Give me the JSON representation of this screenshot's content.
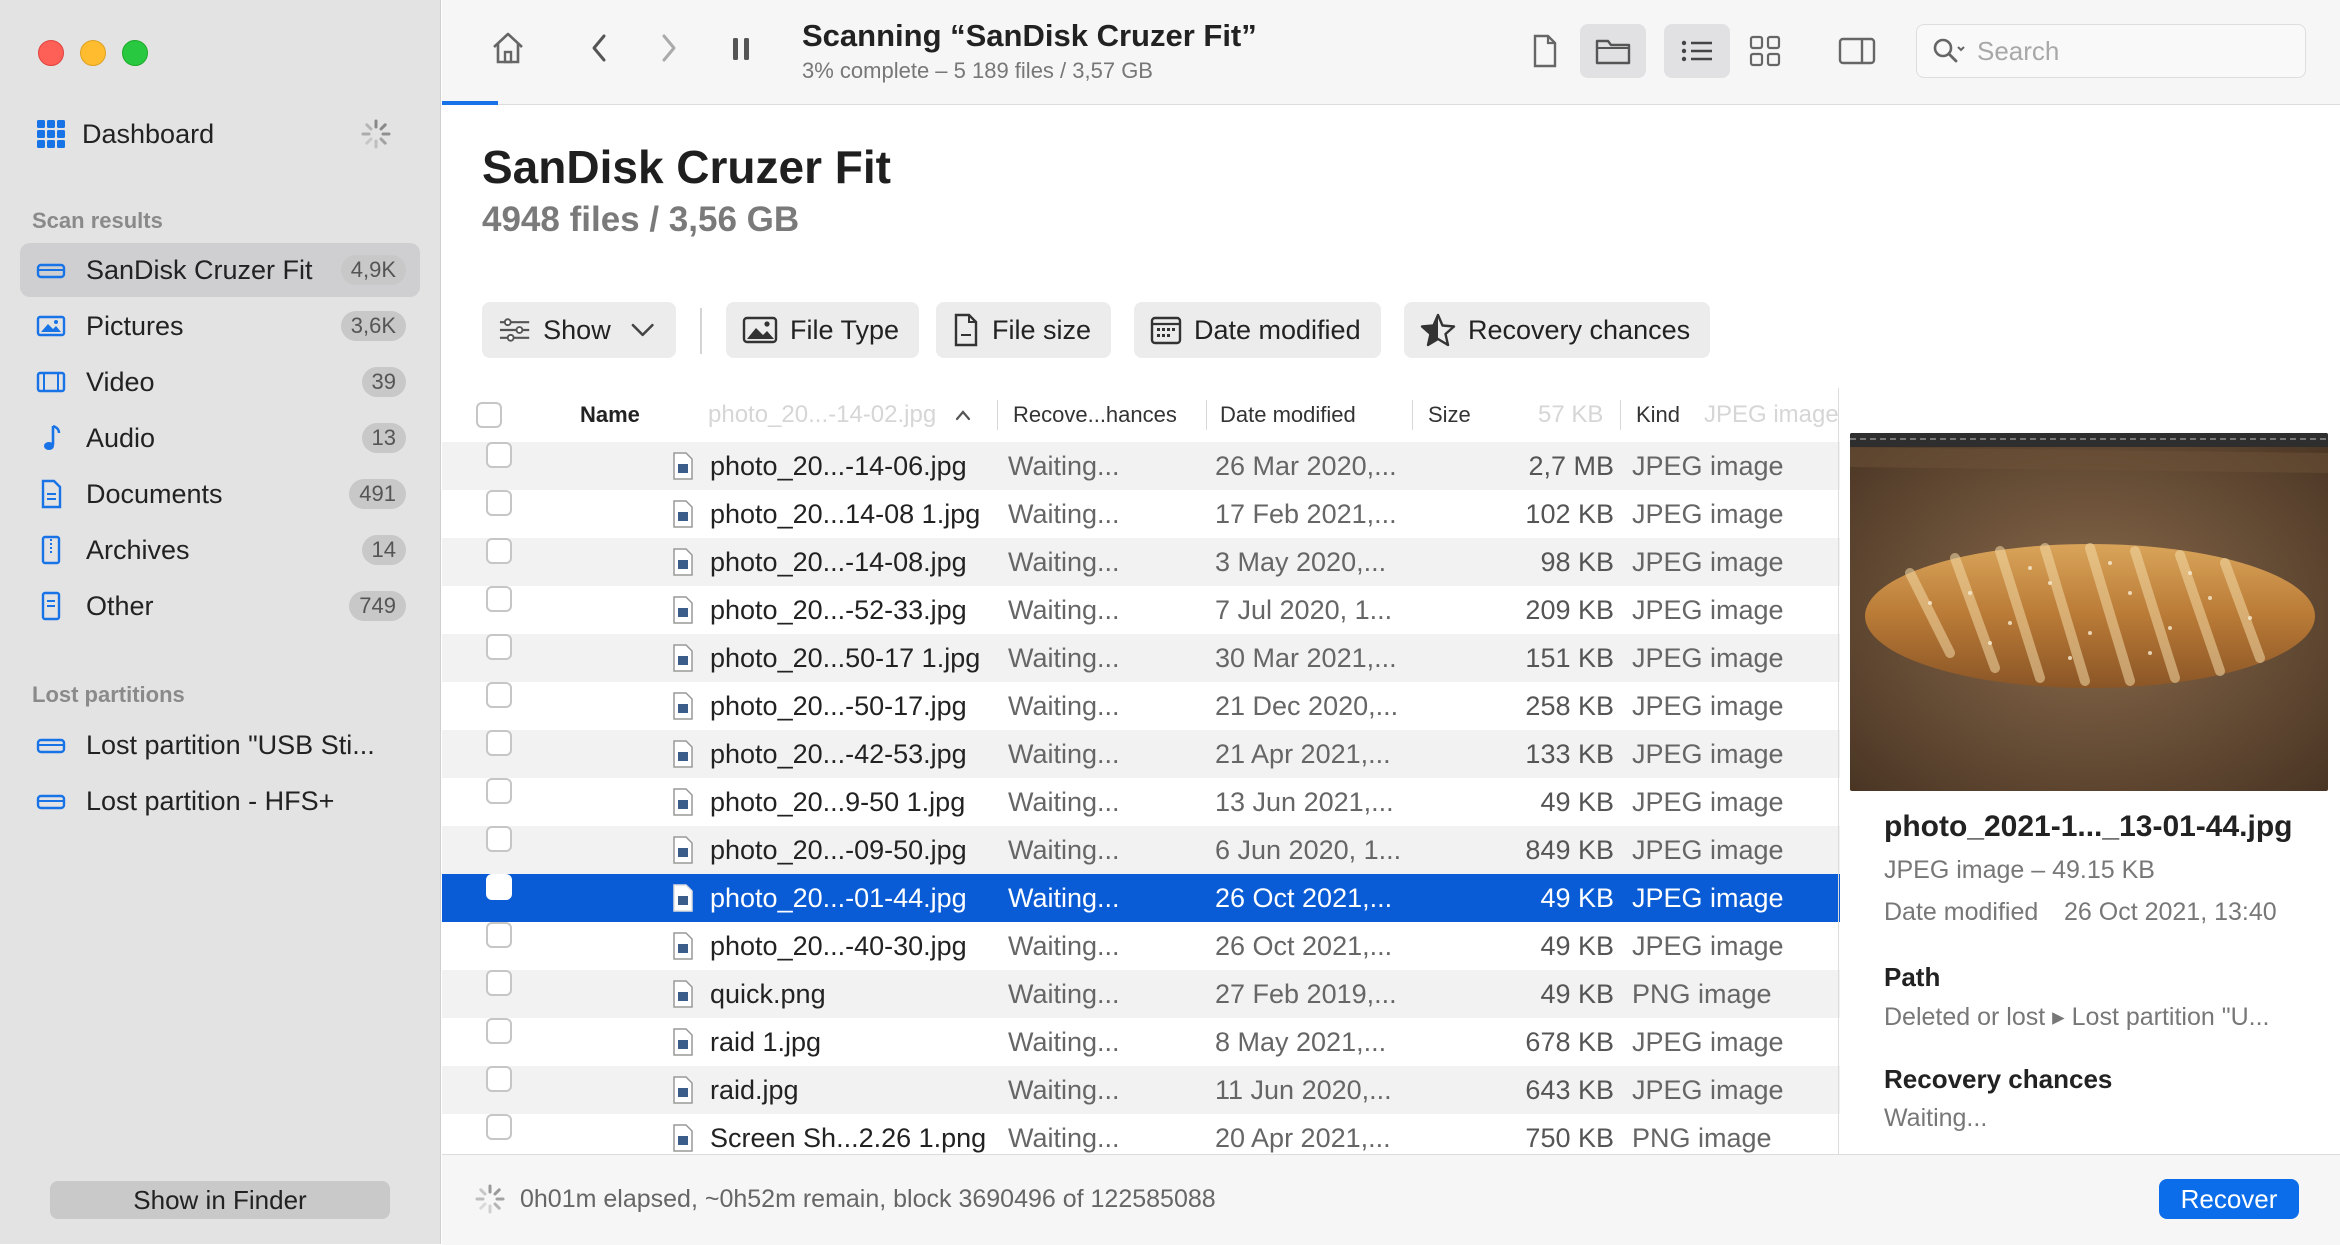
{
  "sidebar": {
    "dashboard_label": "Dashboard",
    "scan_results_title": "Scan results",
    "scan_items": [
      {
        "label": "SanDisk Cruzer Fit",
        "count": "4,9K",
        "icon": "drive-icon"
      },
      {
        "label": "Pictures",
        "count": "3,6K",
        "icon": "pictures-icon"
      },
      {
        "label": "Video",
        "count": "39",
        "icon": "video-icon"
      },
      {
        "label": "Audio",
        "count": "13",
        "icon": "audio-icon"
      },
      {
        "label": "Documents",
        "count": "491",
        "icon": "document-icon"
      },
      {
        "label": "Archives",
        "count": "14",
        "icon": "archive-icon"
      },
      {
        "label": "Other",
        "count": "749",
        "icon": "other-icon"
      }
    ],
    "lost_partitions_title": "Lost partitions",
    "lost_items": [
      {
        "label": "Lost partition \"USB Sti...",
        "icon": "drive-icon"
      },
      {
        "label": "Lost partition - HFS+",
        "icon": "drive-icon"
      }
    ],
    "show_in_finder": "Show in Finder"
  },
  "toolbar": {
    "title": "Scanning “SanDisk Cruzer Fit”",
    "subtitle": "3% complete – 5 189 files / 3,57 GB",
    "search_placeholder": "Search",
    "progress_fraction": 0.03
  },
  "header": {
    "title": "SanDisk Cruzer Fit",
    "subtitle": "4948 files / 3,56 GB"
  },
  "filters": {
    "show": "Show",
    "file_type": "File Type",
    "file_size": "File size",
    "date_modified": "Date modified",
    "recovery_chances": "Recovery chances"
  },
  "table": {
    "headers": {
      "name": "Name",
      "recovery": "Recove...hances",
      "date": "Date modified",
      "size": "Size",
      "kind": "Kind",
      "ghost_name": "photo_20...-14-02.jpg",
      "ghost_size": "57 KB",
      "ghost_kind": "JPEG image"
    },
    "rows": [
      {
        "name": "photo_20...-14-06.jpg",
        "rec": "Waiting...",
        "date": "26 Mar 2020,...",
        "size": "2,7 MB",
        "kind": "JPEG image"
      },
      {
        "name": "photo_20...14-08 1.jpg",
        "rec": "Waiting...",
        "date": "17 Feb 2021,...",
        "size": "102 KB",
        "kind": "JPEG image"
      },
      {
        "name": "photo_20...-14-08.jpg",
        "rec": "Waiting...",
        "date": "3 May 2020,...",
        "size": "98 KB",
        "kind": "JPEG image"
      },
      {
        "name": "photo_20...-52-33.jpg",
        "rec": "Waiting...",
        "date": "7 Jul 2020, 1...",
        "size": "209 KB",
        "kind": "JPEG image"
      },
      {
        "name": "photo_20...50-17 1.jpg",
        "rec": "Waiting...",
        "date": "30 Mar 2021,...",
        "size": "151 KB",
        "kind": "JPEG image"
      },
      {
        "name": "photo_20...-50-17.jpg",
        "rec": "Waiting...",
        "date": "21 Dec 2020,...",
        "size": "258 KB",
        "kind": "JPEG image"
      },
      {
        "name": "photo_20...-42-53.jpg",
        "rec": "Waiting...",
        "date": "21 Apr 2021,...",
        "size": "133 KB",
        "kind": "JPEG image"
      },
      {
        "name": "photo_20...9-50 1.jpg",
        "rec": "Waiting...",
        "date": "13 Jun 2021,...",
        "size": "49 KB",
        "kind": "JPEG image"
      },
      {
        "name": "photo_20...-09-50.jpg",
        "rec": "Waiting...",
        "date": "6 Jun 2020, 1...",
        "size": "849 KB",
        "kind": "JPEG image"
      },
      {
        "name": "photo_20...-01-44.jpg",
        "rec": "Waiting...",
        "date": "26 Oct 2021,...",
        "size": "49 KB",
        "kind": "JPEG image"
      },
      {
        "name": "photo_20...-40-30.jpg",
        "rec": "Waiting...",
        "date": "26 Oct 2021,...",
        "size": "49 KB",
        "kind": "JPEG image"
      },
      {
        "name": "quick.png",
        "rec": "Waiting...",
        "date": "27 Feb 2019,...",
        "size": "49 KB",
        "kind": "PNG image"
      },
      {
        "name": "raid 1.jpg",
        "rec": "Waiting...",
        "date": "8 May 2021,...",
        "size": "678 KB",
        "kind": "JPEG image"
      },
      {
        "name": "raid.jpg",
        "rec": "Waiting...",
        "date": "11 Jun 2020,...",
        "size": "643 KB",
        "kind": "JPEG image"
      },
      {
        "name": "Screen Sh...2.26 1.png",
        "rec": "Waiting...",
        "date": "20 Apr 2021,...",
        "size": "750 KB",
        "kind": "PNG image"
      }
    ]
  },
  "preview": {
    "name": "photo_2021-1..._13-01-44.jpg",
    "kind_size": "JPEG image – 49.15 KB",
    "date_label": "Date modified",
    "date_value": "26 Oct 2021, 13:40",
    "path_title": "Path",
    "path_value": "Deleted or lost ▸ Lost partition \"U...",
    "recovery_title": "Recovery chances",
    "recovery_value": "Waiting..."
  },
  "status": {
    "text": "0h01m elapsed, ~0h52m remain, block 3690496 of 122585088",
    "recover_button": "Recover"
  },
  "colors": {
    "accent": "#0b6dea",
    "selection": "#0a5cd6",
    "sidebar_bg": "#e3e3e3"
  }
}
